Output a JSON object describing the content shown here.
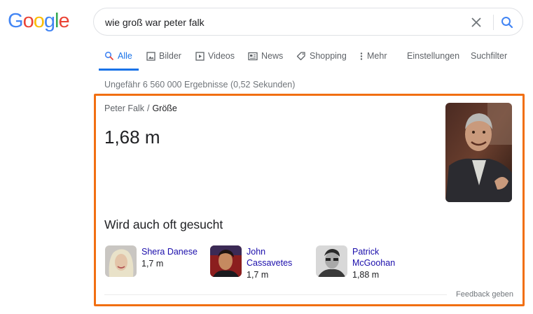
{
  "logo": {
    "letters": [
      "G",
      "o",
      "o",
      "g",
      "l",
      "e"
    ],
    "colors": [
      "#4285f4",
      "#ea4335",
      "#fbbc05",
      "#4285f4",
      "#34a853",
      "#ea4335"
    ]
  },
  "search": {
    "query": "wie groß war peter falk"
  },
  "tabs": [
    {
      "label": "Alle",
      "icon": "search-icon",
      "active": true
    },
    {
      "label": "Bilder",
      "icon": "image-icon"
    },
    {
      "label": "Videos",
      "icon": "video-icon"
    },
    {
      "label": "News",
      "icon": "news-icon"
    },
    {
      "label": "Shopping",
      "icon": "tag-icon"
    },
    {
      "label": "Mehr",
      "icon": "more-vert-icon"
    },
    {
      "label": "Einstellungen"
    },
    {
      "label": "Suchfilter"
    }
  ],
  "result_stats": "Ungefähr 6 560 000 Ergebnisse (0,52 Sekunden)",
  "answer_card": {
    "breadcrumb": {
      "entity": "Peter Falk",
      "separator": "/",
      "attribute": "Größe"
    },
    "value": "1,68 m",
    "also_searched_heading": "Wird auch oft gesucht",
    "people": [
      {
        "name": "Shera Danese",
        "value": "1,7 m"
      },
      {
        "name": "John Cassavetes",
        "value": "1,7 m"
      },
      {
        "name": "Patrick McGoohan",
        "value": "1,88 m"
      }
    ],
    "feedback": "Feedback geben"
  },
  "colors": {
    "accent": "#1a73e8",
    "link": "#1a0dab",
    "highlight_border": "#f16f12"
  }
}
